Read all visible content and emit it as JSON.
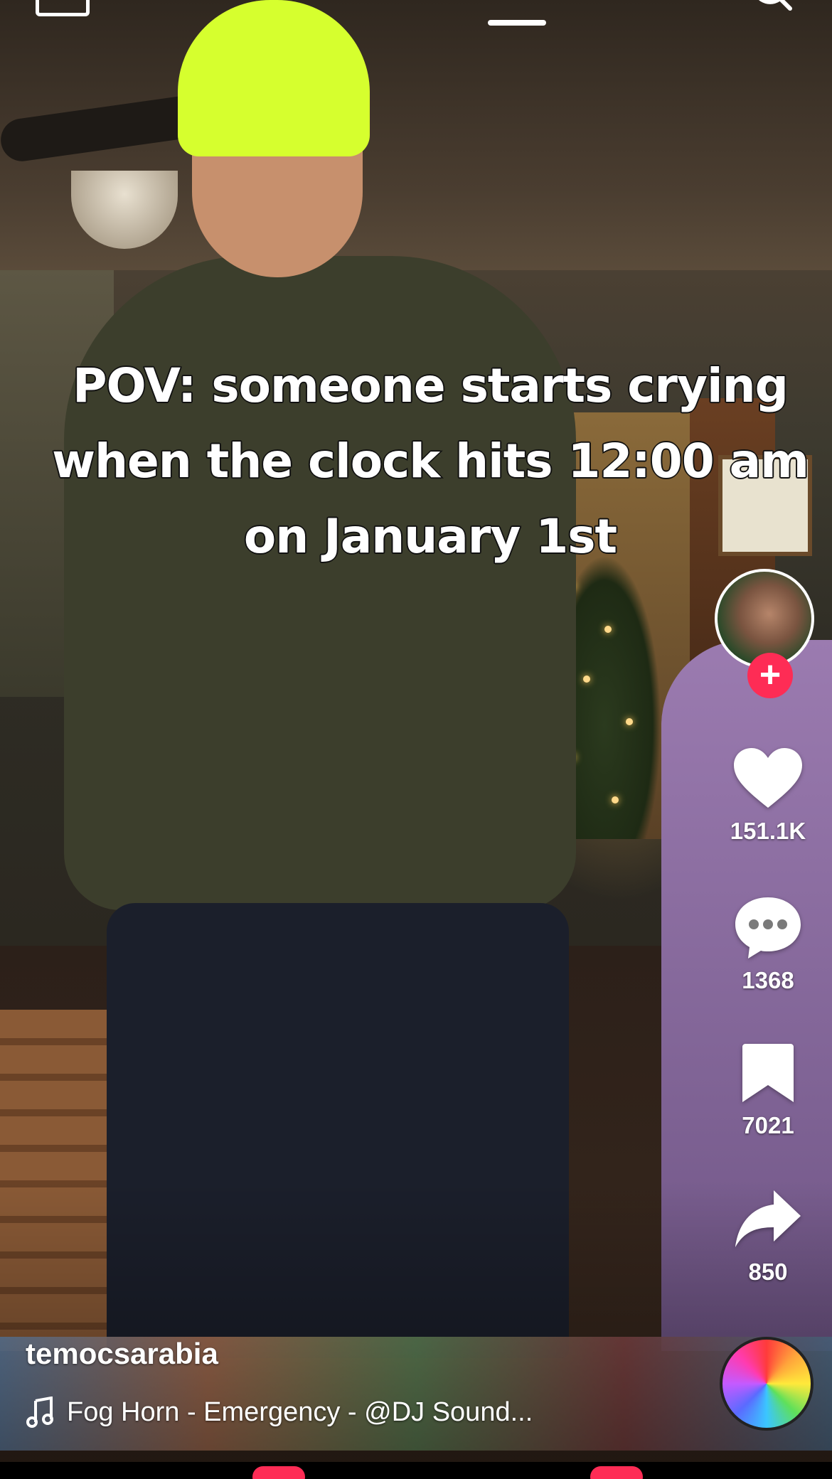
{
  "caption": {
    "lines": [
      "POV: someone starts crying",
      "when the clock hits 12:00 am",
      "on January 1st"
    ]
  },
  "actions": {
    "likes": "151.1K",
    "comments": "1368",
    "saves": "7021",
    "shares": "850"
  },
  "video": {
    "username": "temocsarabia",
    "sound": "Fog Horn - Emergency - @DJ Sound..."
  },
  "colors": {
    "accent": "#fe2c55",
    "text": "#ffffff"
  },
  "icons": {
    "like": "heart-icon",
    "comment": "comment-bubble-icon",
    "save": "bookmark-icon",
    "share": "share-arrow-icon",
    "follow": "plus-icon",
    "sound": "music-note-icon",
    "search": "search-icon"
  }
}
